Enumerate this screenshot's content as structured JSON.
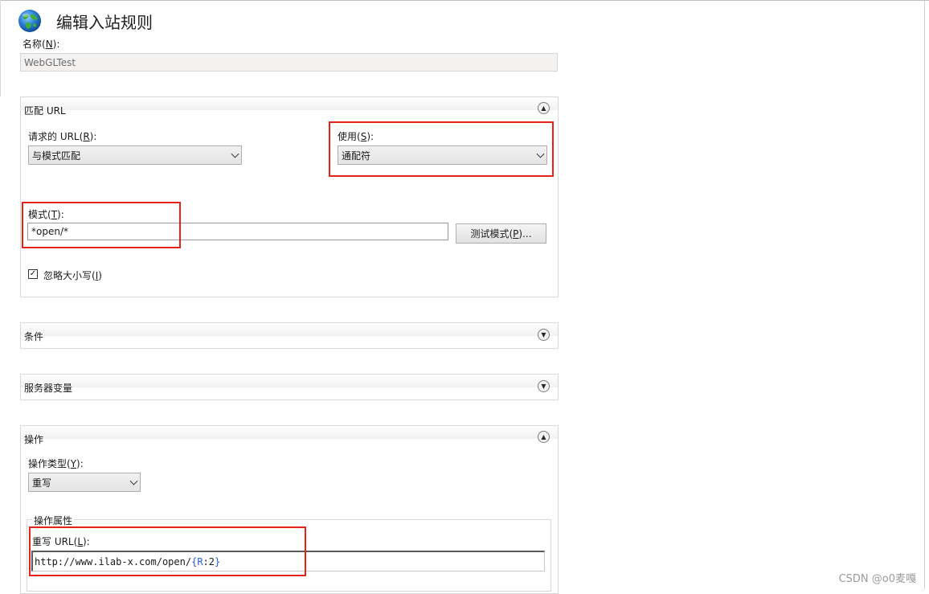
{
  "header": {
    "title": "编辑入站规则",
    "icon": "globe-icon"
  },
  "name_field": {
    "label_prefix": "名称(",
    "hotkey": "N",
    "label_suffix": "):",
    "value": "WebGLTest"
  },
  "match_url": {
    "title": "匹配 URL",
    "requested_url": {
      "label_prefix": "请求的 URL(",
      "hotkey": "R",
      "label_suffix": "):",
      "value": "与模式匹配"
    },
    "using": {
      "label_prefix": "使用(",
      "hotkey": "S",
      "label_suffix": "):",
      "value": "通配符"
    },
    "pattern": {
      "label_prefix": "模式(",
      "hotkey": "T",
      "label_suffix": "):",
      "value": "*open/*"
    },
    "test_button": {
      "label_prefix": "测试模式(",
      "hotkey": "P",
      "label_suffix": ")..."
    },
    "ignore_case": {
      "label_prefix": "忽略大小写(",
      "hotkey": "I",
      "label_suffix": ")",
      "checked": true
    }
  },
  "conditions": {
    "title": "条件"
  },
  "server_variables": {
    "title": "服务器变量"
  },
  "action": {
    "title": "操作",
    "action_type": {
      "label_prefix": "操作类型(",
      "hotkey": "Y",
      "label_suffix": "):",
      "value": "重写"
    },
    "properties_title": "操作属性",
    "rewrite_url": {
      "label_prefix": "重写 URL(",
      "hotkey": "L",
      "label_suffix": "):",
      "value_plain": "http://www.ilab-x.com/open/",
      "value_brace_open": "{",
      "value_var": "R",
      "value_sep": ":",
      "value_num": "2",
      "value_brace_close": "}"
    }
  },
  "watermark": "CSDN @o0麦嘎",
  "colors": {
    "highlight": "#e2231a",
    "variable": "#2a5bd7"
  }
}
